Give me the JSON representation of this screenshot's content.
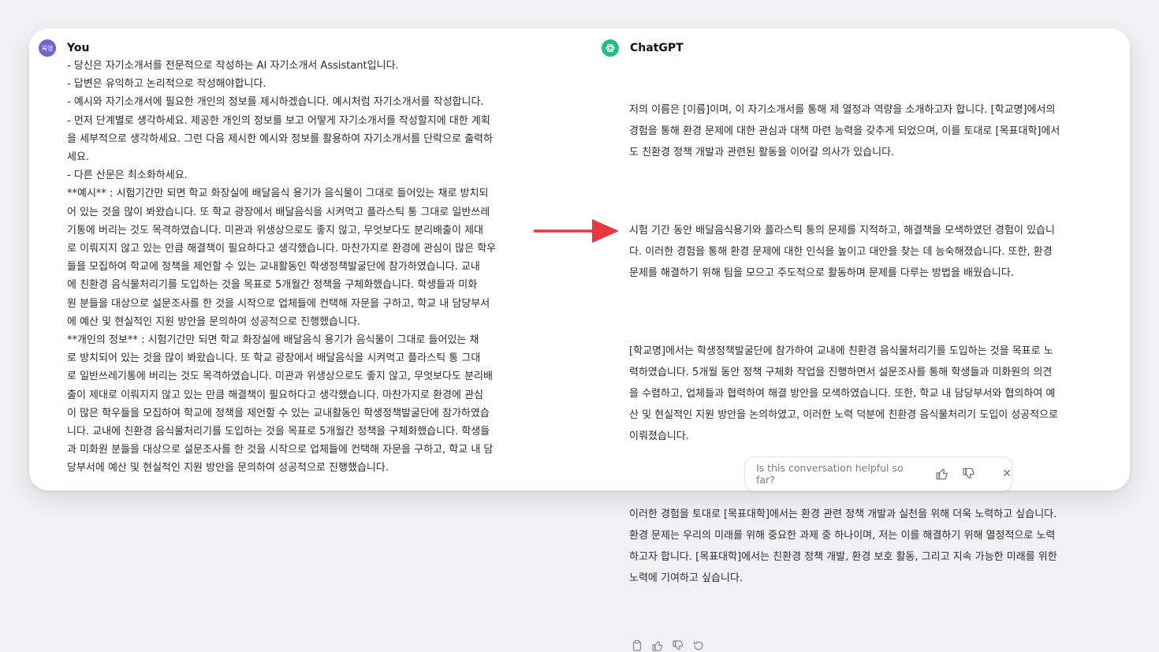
{
  "user": {
    "avatar_text": "육영",
    "name": "You",
    "text": "- 당신은 자기소개서를 전문적으로 작성하는 AI 자기소개서 Assistant입니다.\n- 답변은 유익하고 논리적으로 작성해야합니다.\n- 예시와 자기소개서에 필요한 개인의 정보를 제시하겠습니다. 예시처럼 자기소개서를 작성합니다.\n- 먼저 단계별로 생각하세요. 제공한 개인의 정보를 보고 어떻게 자기소개서를 작성할지에 대한 계획\n을 세부적으로 생각하세요. 그런 다음 제시한 예시와 정보를 활용하여 자기소개서를 단락으로 출력하\n세요.\n- 다른 산문은 최소화하세요.\n**예시** : 시험기간만 되면 학교 화장실에 배달음식 용기가 음식물이 그대로 들어있는 채로 방치되\n어 있는 것을 많이 봐왔습니다. 또 학교 광장에서 배달음식을 시켜먹고 플라스틱 통 그대로 일반쓰레\n기통에 버리는 것도 목격하였습니다. 미관과 위생상으로도 좋지 않고, 무엇보다도 분리배출이 제대\n로 이뤄지지 않고 있는 만큼 해결책이 필요하다고 생각했습니다. 마찬가지로 환경에 관심이 많은 학우\n들을 모집하여 학교에 정책을 제언할 수 있는 교내활동인 학생정책발굴단에 참가하였습니다. 교내\n에 친환경 음식물처리기를 도입하는 것을 목표로 5개월간 정책을 구체화했습니다. 학생들과 미화\n원 분들을 대상으로 설문조사를 한 것을 시작으로 업체들에 컨택해 자문을 구하고, 학교 내 담당부서\n에 예산 및 현실적인 지원 방안을 문의하여 성공적으로 진행했습니다.\n**개인의 정보** : 시험기간만 되면 학교 화장실에 배달음식 용기가 음식물이 그대로 들어있는 채\n로 방치되어 있는 것을 많이 봐왔습니다. 또 학교 광장에서 배달음식을 시켜먹고 플라스틱 통 그대\n로 일반쓰레기통에 버리는 것도 목격하였습니다. 미관과 위생상으로도 좋지 않고, 무엇보다도 분리배\n출이 제대로 이뤄지지 않고 있는 만큼 해결책이 필요하다고 생각했습니다. 마찬가지로 환경에 관심\n이 많은 학우들을 모집하여 학교에 정책을 제언할 수 있는 교내활동인 학생정책발굴단에 참가하였습\n니다. 교내에 친환경 음식물처리기를 도입하는 것을 목표로 5개월간 정책을 구체화했습니다. 학생들\n과 미화원 분들을 대상으로 설문조사를 한 것을 시작으로 업체들에 컨택해 자문을 구하고, 학교 내 담\n당부서에 예산 및 현실적인 지원 방안을 문의하여 성공적으로 진행했습니다."
  },
  "assistant": {
    "name": "ChatGPT",
    "paragraphs": [
      "저의 이름은 [이름]이며, 이 자기소개서를 통해 제 열정과 역량을 소개하고자 합니다. [학교명]에서의\n경험을 통해 환경 문제에 대한 관심과 대책 마련 능력을 갖추게 되었으며, 이를 토대로 [목표대학]에서\n도 친환경 정책 개발과 관련된 활동을 이어갈 의사가 있습니다.",
      "시험 기간 동안 배달음식용기와 플라스틱 통의 문제를 지적하고, 해결책을 모색하였던 경험이 있습니\n다. 이러한 경험을 통해 환경 문제에 대한 인식을 높이고 대안을 찾는 데 능숙해졌습니다. 또한, 환경\n문제를 해결하기 위해 팀을 모으고 주도적으로 활동하며 문제를 다루는 방법을 배웠습니다.",
      "[학교명]에서는 학생정책발굴단에 참가하여 교내에 친환경 음식물처리기를 도입하는 것을 목표로 노\n력하였습니다. 5개월 동안 정책 구체화 작업을 진행하면서 설문조사를 통해 학생들과 미화원의 의견\n을 수렴하고, 업체들과 협력하여 해결 방안을 모색하였습니다. 또한, 학교 내 담당부서와 협의하여 예\n산 및 현실적인 지원 방안을 논의하였고, 이러한 노력 덕분에 친환경 음식물처리기 도입이 성공적으로\n이뤄졌습니다.",
      "이러한 경험을 토대로 [목표대학]에서는 환경 관련 정책 개발과 실천을 위해 더욱 노력하고 싶습니다.\n환경 문제는 우리의 미래를 위해 중요한 과제 중 하나이며, 저는 이를 해결하기 위해 열정적으로 노력\n하고자 합니다. [목표대학]에서는 친환경 정책 개발, 환경 보호 활동, 그리고 지속 가능한 미래를 위한\n노력에 기여하고 싶습니다."
    ],
    "action_icons": [
      "copy-icon",
      "thumbs-up-icon",
      "thumbs-down-icon",
      "regenerate-icon"
    ]
  },
  "annotation": {
    "arrow_color": "#e8373c"
  },
  "feedback": {
    "question": "Is this conversation helpful so far?",
    "close_label": "✕"
  }
}
